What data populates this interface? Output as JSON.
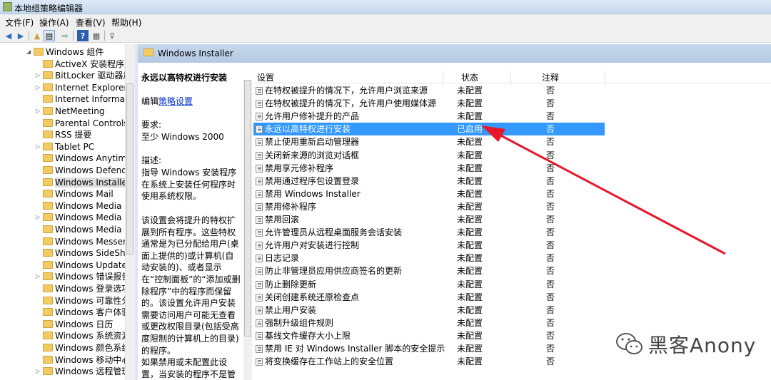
{
  "window": {
    "title": "本地组策略编辑器"
  },
  "menu": [
    "文件(F)",
    "操作(A)",
    "查看(V)",
    "帮助(H)"
  ],
  "toolbar": [
    "back-icon",
    "forward-icon",
    "folder-up-icon",
    "show-hide-tree-icon",
    "export-icon",
    "help-icon",
    "properties-icon",
    "filter-icon"
  ],
  "tree": [
    {
      "label": "Windows 组件",
      "twisty": "◢"
    },
    {
      "label": "ActiveX 安装程序服",
      "twisty": ""
    },
    {
      "label": "BitLocker 驱动器加",
      "twisty": "▷"
    },
    {
      "label": "Internet Explorer",
      "twisty": "▷"
    },
    {
      "label": "Internet Informati",
      "twisty": ""
    },
    {
      "label": "NetMeeting",
      "twisty": "▷"
    },
    {
      "label": "Parental Controls",
      "twisty": ""
    },
    {
      "label": "RSS 提要",
      "twisty": ""
    },
    {
      "label": "Tablet PC",
      "twisty": "▷"
    },
    {
      "label": "Windows Anytime",
      "twisty": ""
    },
    {
      "label": "Windows Defende",
      "twisty": ""
    },
    {
      "label": "Windows Installer",
      "twisty": "",
      "selected": true
    },
    {
      "label": "Windows Mail",
      "twisty": ""
    },
    {
      "label": "Windows Media C",
      "twisty": ""
    },
    {
      "label": "Windows Media P",
      "twisty": "▷"
    },
    {
      "label": "Windows Media 数",
      "twisty": ""
    },
    {
      "label": "Windows Messen",
      "twisty": ""
    },
    {
      "label": "Windows SideSho",
      "twisty": ""
    },
    {
      "label": "Windows Update",
      "twisty": ""
    },
    {
      "label": "Windows 错误报告",
      "twisty": "▷"
    },
    {
      "label": "Windows 登录选项",
      "twisty": ""
    },
    {
      "label": "Windows 可靠性分",
      "twisty": ""
    },
    {
      "label": "Windows 客户体验",
      "twisty": ""
    },
    {
      "label": "Windows 日历",
      "twisty": ""
    },
    {
      "label": "Windows 系统资源",
      "twisty": ""
    },
    {
      "label": "Windows 颜色系统",
      "twisty": ""
    },
    {
      "label": "Windows 移动中心",
      "twisty": ""
    },
    {
      "label": "Windows 远程管理",
      "twisty": "▷"
    }
  ],
  "header": {
    "title": "Windows Installer"
  },
  "desc": {
    "heading": "永远以高特权进行安装",
    "edit_prefix": "编辑",
    "edit_link": "策略设置",
    "req_label": "要求:",
    "req_value": "至少 Windows 2000",
    "desc_label": "描述:",
    "p1": "指导 Windows 安装程序在系统上安装任何程序时使用系统权限。",
    "p2": "该设置会将提升的特权扩展到所有程序。这些特权通常是为已分配给用户(桌面上提供的)或计算机(自动安装的)、或者显示在“控制面板”的“添加或删除程序”中的程序而保留的。该设置允许用户安装需要访问用户可能无查看或更改权限目录(包括受高度限制的计算机上的目录)的程序。",
    "p3": "如果禁用或未配置此设置，当安装的程序不是管理员分"
  },
  "columns": {
    "setting": "设置",
    "state": "状态",
    "comment": "注释"
  },
  "rows": [
    {
      "setting": "在特权被提升的情况下，允许用户浏览来源",
      "state": "未配置",
      "comment": "否"
    },
    {
      "setting": "在特权被提升的情况下，允许用户使用媒体源",
      "state": "未配置",
      "comment": "否"
    },
    {
      "setting": "允许用户修补提升的产品",
      "state": "未配置",
      "comment": "否"
    },
    {
      "setting": "永远以高特权进行安装",
      "state": "已启用",
      "comment": "否",
      "selected": true
    },
    {
      "setting": "禁止使用重新启动管理器",
      "state": "未配置",
      "comment": "否"
    },
    {
      "setting": "关闭新来源的浏览对话框",
      "state": "未配置",
      "comment": "否"
    },
    {
      "setting": "禁用享元修补程序",
      "state": "未配置",
      "comment": "否"
    },
    {
      "setting": "禁用通过程序包设置登录",
      "state": "未配置",
      "comment": "否"
    },
    {
      "setting": "禁用 Windows Installer",
      "state": "未配置",
      "comment": "否"
    },
    {
      "setting": "禁用修补程序",
      "state": "未配置",
      "comment": "否"
    },
    {
      "setting": "禁用回滚",
      "state": "未配置",
      "comment": "否"
    },
    {
      "setting": "允许管理员从远程桌面服务会话安装",
      "state": "未配置",
      "comment": "否"
    },
    {
      "setting": "允许用户对安装进行控制",
      "state": "未配置",
      "comment": "否"
    },
    {
      "setting": "日志记录",
      "state": "未配置",
      "comment": "否"
    },
    {
      "setting": "防止非管理员应用供应商签名的更新",
      "state": "未配置",
      "comment": "否"
    },
    {
      "setting": "防止删除更新",
      "state": "未配置",
      "comment": "否"
    },
    {
      "setting": "关闭创建系统还原检查点",
      "state": "未配置",
      "comment": "否"
    },
    {
      "setting": "禁止用户安装",
      "state": "未配置",
      "comment": "否"
    },
    {
      "setting": "强制升级组件规则",
      "state": "未配置",
      "comment": "否"
    },
    {
      "setting": "基线文件缓存大小上限",
      "state": "未配置",
      "comment": "否"
    },
    {
      "setting": "禁用 IE 对 Windows Installer 脚本的安全提示",
      "state": "未配置",
      "comment": "否"
    },
    {
      "setting": "将变换缓存在工作站上的安全位置",
      "state": "未配置",
      "comment": "否"
    }
  ],
  "annotation": {
    "color": "#e8182a"
  },
  "watermark": {
    "text": "黑客Anony"
  }
}
